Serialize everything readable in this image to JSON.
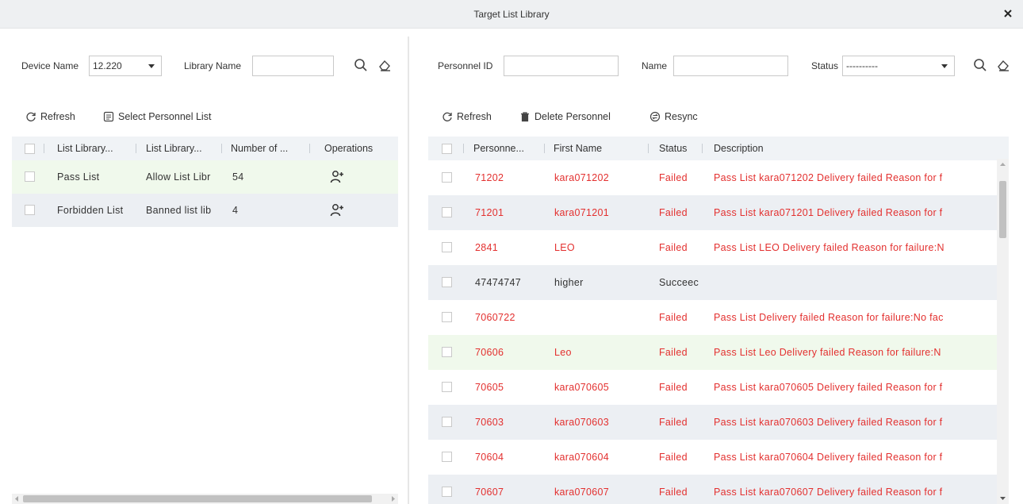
{
  "window": {
    "title": "Target List Library"
  },
  "left": {
    "filters": {
      "device_name_label": "Device Name",
      "device_name_value": "12.220",
      "library_name_label": "Library Name",
      "library_name_value": ""
    },
    "actions": {
      "refresh": "Refresh",
      "select_personnel_list": "Select Personnel List"
    },
    "columns": [
      "List Library...",
      "List Library...",
      "Number of ...",
      "Operations"
    ],
    "rows": [
      {
        "name": "Pass List",
        "type": "Allow List Libr",
        "count": "54",
        "highlight": "#f0f9ec"
      },
      {
        "name": "Forbidden List",
        "type": "Banned list lib",
        "count": "4",
        "highlight": "#eceff3"
      }
    ]
  },
  "right": {
    "filters": {
      "personnel_id_label": "Personnel ID",
      "personnel_id_value": "",
      "name_label": "Name",
      "name_value": "",
      "status_label": "Status",
      "status_value": "----------"
    },
    "actions": {
      "refresh": "Refresh",
      "delete_personnel": "Delete Personnel",
      "resync": "Resync"
    },
    "columns": [
      "Personne...",
      "First Name",
      "Status",
      "Description"
    ],
    "rows": [
      {
        "id": "71202",
        "first_name": "kara071202",
        "status": "Failed",
        "description": "Pass List kara071202 Delivery failed Reason for f",
        "failed": true,
        "bg": "#ffffff"
      },
      {
        "id": "71201",
        "first_name": "kara071201",
        "status": "Failed",
        "description": "Pass List kara071201 Delivery failed Reason for f",
        "failed": true,
        "bg": "#eceff3"
      },
      {
        "id": "2841",
        "first_name": "LEO",
        "status": "Failed",
        "description": "Pass List LEO Delivery failed Reason for failure:N",
        "failed": true,
        "bg": "#ffffff"
      },
      {
        "id": "47474747",
        "first_name": "higher",
        "status": "Succeec",
        "description": "",
        "failed": false,
        "bg": "#eceff3"
      },
      {
        "id": "7060722",
        "first_name": "",
        "status": "Failed",
        "description": "Pass List Delivery failed Reason for failure:No fac",
        "failed": true,
        "bg": "#ffffff"
      },
      {
        "id": "70606",
        "first_name": "Leo",
        "status": "Failed",
        "description": "Pass List Leo Delivery failed Reason for failure:N",
        "failed": true,
        "bg": "#f0f9ec"
      },
      {
        "id": "70605",
        "first_name": "kara070605",
        "status": "Failed",
        "description": "Pass List kara070605 Delivery failed Reason for f",
        "failed": true,
        "bg": "#ffffff"
      },
      {
        "id": "70603",
        "first_name": "kara070603",
        "status": "Failed",
        "description": "Pass List kara070603 Delivery failed Reason for f",
        "failed": true,
        "bg": "#eceff3"
      },
      {
        "id": "70604",
        "first_name": "kara070604",
        "status": "Failed",
        "description": "Pass List kara070604 Delivery failed Reason for f",
        "failed": true,
        "bg": "#ffffff"
      },
      {
        "id": "70607",
        "first_name": "kara070607",
        "status": "Failed",
        "description": "Pass List kara070607 Delivery failed Reason for f",
        "failed": true,
        "bg": "#eceff3"
      }
    ]
  },
  "colors": {
    "failed_text": "#e3302f",
    "header_bg": "#f0f3f6",
    "selected_row": "#f0f9ec",
    "alt_row": "#eceff3"
  },
  "icons": {
    "close": "close-icon",
    "search": "search-icon",
    "clear": "eraser-icon",
    "refresh": "refresh-icon",
    "select_list": "list-icon",
    "delete": "trash-icon",
    "resync": "resync-icon",
    "add_person": "add-person-icon"
  }
}
